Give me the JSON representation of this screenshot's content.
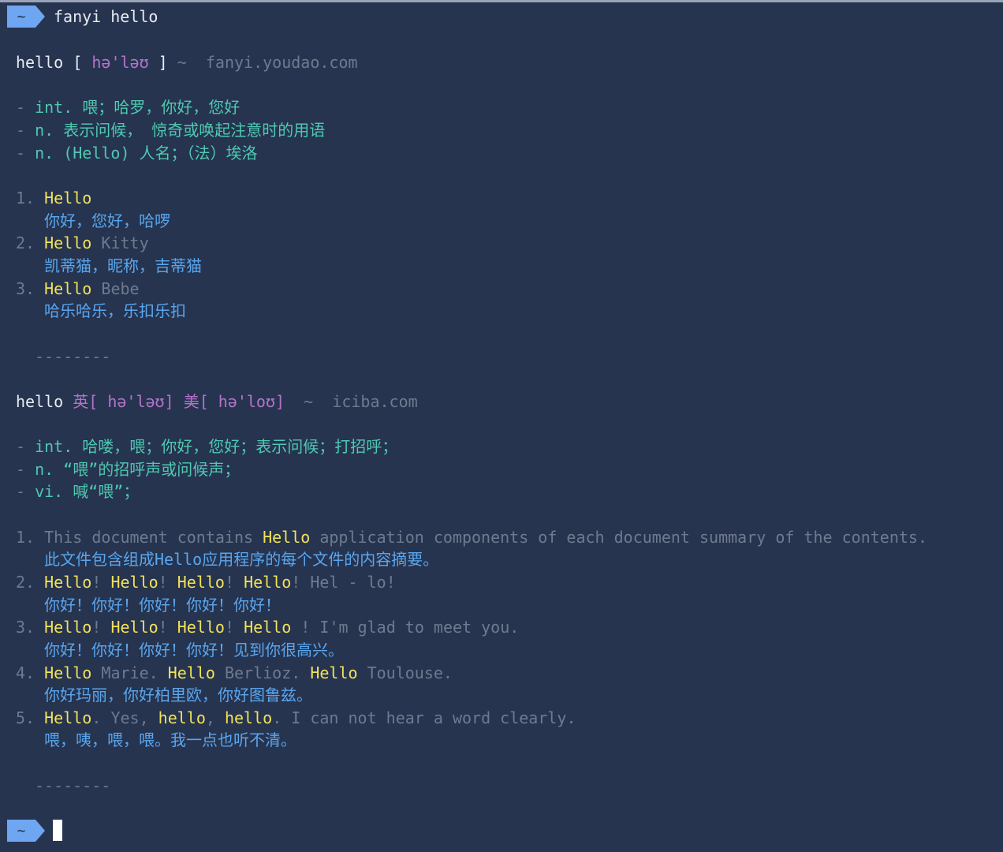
{
  "prompt_symbol": "~",
  "command": "fanyi hello",
  "youdao": {
    "word": "hello",
    "lbr": "[",
    "phonetic": "hə'ləʊ",
    "rbr": "]",
    "tilde": "~",
    "source": "fanyi.youdao.com",
    "definitions": [
      {
        "dash": "-",
        "text": "int. 喂；哈罗，你好，您好"
      },
      {
        "dash": "-",
        "text": "n. 表示问候， 惊奇或唤起注意时的用语"
      },
      {
        "dash": "-",
        "text": "n. (Hello) 人名；（法）埃洛"
      }
    ],
    "examples": [
      {
        "num": "1.",
        "hl": "Hello",
        "rest": "",
        "trans": "你好，您好，哈啰"
      },
      {
        "num": "2.",
        "hl": "Hello",
        "rest": " Kitty",
        "trans": "凯蒂猫，昵称，吉蒂猫"
      },
      {
        "num": "3.",
        "hl": "Hello",
        "rest": " Bebe",
        "trans": "哈乐哈乐，乐扣乐扣"
      }
    ],
    "separator": "--------"
  },
  "iciba": {
    "word": "hello",
    "uk_label": "英",
    "uk_phonetic": "[ hə'ləʊ]",
    "us_label": "美",
    "us_phonetic": "[ hə'loʊ]",
    "tilde": "~",
    "source": "iciba.com",
    "definitions": [
      {
        "dash": "-",
        "text": "int. 哈喽，喂；你好，您好；表示问候；打招呼；"
      },
      {
        "dash": "-",
        "text": "n. “喂”的招呼声或问候声；"
      },
      {
        "dash": "-",
        "text": "vi. 喊“喂”；"
      }
    ],
    "examples": {
      "e1": {
        "num": "1.",
        "a": "This document contains ",
        "b": "Hello",
        "c": " application components of each document summary of the contents.",
        "trans": "此文件包含组成Hello应用程序的每个文件的内容摘要。"
      },
      "e2": {
        "num": "2.",
        "h1": "Hello",
        "p1": "! ",
        "h2": "Hello",
        "p2": "! ",
        "h3": "Hello",
        "p3": "! ",
        "h4": "Hello",
        "p4": "! Hel - lo!",
        "trans": "你好！你好！你好！你好！你好！"
      },
      "e3": {
        "num": "3.",
        "h1": "Hello",
        "p1": "! ",
        "h2": "Hello",
        "p2": "! ",
        "h3": "Hello",
        "p3": "! ",
        "h4": "Hello",
        "p4": " ! I'm glad to meet you.",
        "trans": "你好！你好！你好！你好！见到你很高兴。"
      },
      "e4": {
        "num": "4.",
        "h1": "Hello",
        "p1": " Marie. ",
        "h2": "Hello",
        "p2": " Berlioz. ",
        "h3": "Hello",
        "p3": " Toulouse.",
        "trans": "你好玛丽，你好柏里欧，你好图鲁兹。"
      },
      "e5": {
        "num": "5.",
        "h1": "Hello",
        "p1": ". Yes, ",
        "h2": "hello",
        "p2": ", ",
        "h3": "hello",
        "p3": ". I can not hear a word clearly.",
        "trans": "喂，咦，喂，喂。我一点也听不清。"
      }
    },
    "separator": "--------"
  },
  "colors": {
    "background": "#263450",
    "prompt_bg": "#6fa6f2",
    "highlight": "#f2e25a",
    "definition": "#4fc9b0",
    "translation": "#5aa6ee",
    "phonetic": "#b673c9",
    "dim": "#6f7a8e"
  }
}
